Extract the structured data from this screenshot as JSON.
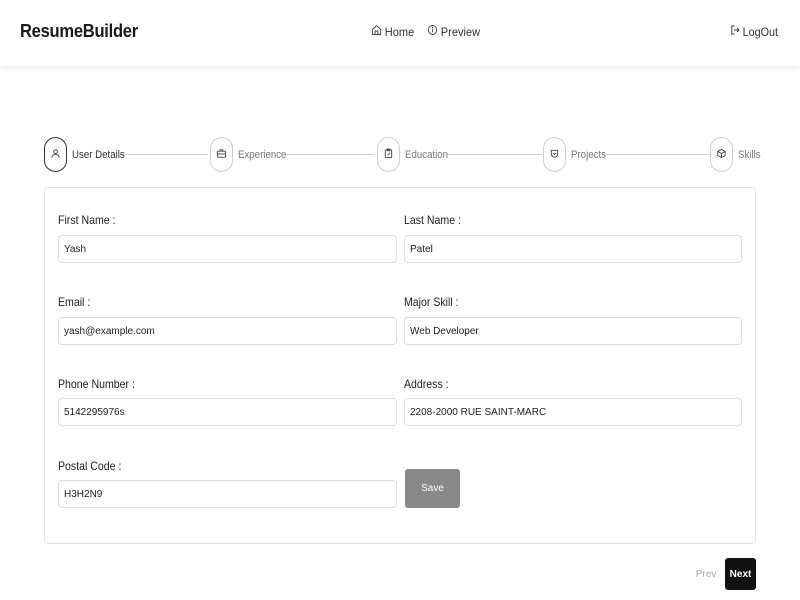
{
  "navbar": {
    "brand": "ResumeBuilder",
    "links": [
      {
        "label": "Home",
        "icon": "home-icon"
      },
      {
        "label": "Preview",
        "icon": "info-icon"
      }
    ],
    "logout": {
      "label": "LogOut",
      "icon": "logout-icon"
    }
  },
  "stepper": {
    "active_index": 0,
    "steps": [
      {
        "label": "User Details",
        "icon": "user-icon"
      },
      {
        "label": "Experience",
        "icon": "briefcase-icon"
      },
      {
        "label": "Education",
        "icon": "clipboard-edit-icon"
      },
      {
        "label": "Projects",
        "icon": "badge-icon"
      },
      {
        "label": "Skills",
        "icon": "cube-icon"
      }
    ]
  },
  "form": {
    "fields": [
      {
        "label": "First Name :",
        "value": "Yash"
      },
      {
        "label": "Last Name :",
        "value": "Patel"
      },
      {
        "label": "Email :",
        "value": "yash@example.com"
      },
      {
        "label": "Major Skill :",
        "value": "Web Developer"
      },
      {
        "label": "Phone Number :",
        "value": "5142295976s"
      },
      {
        "label": "Address :",
        "value": "2208-2000 RUE SAINT-MARC"
      },
      {
        "label": "Postal Code :",
        "value": "H3H2N9"
      }
    ],
    "save_label": "Save"
  },
  "pagination": {
    "prev_label": "Prev",
    "next_label": "Next"
  },
  "colors": {
    "save_button": "#888888",
    "next_button": "#111111",
    "border": "#dcdcdc"
  }
}
